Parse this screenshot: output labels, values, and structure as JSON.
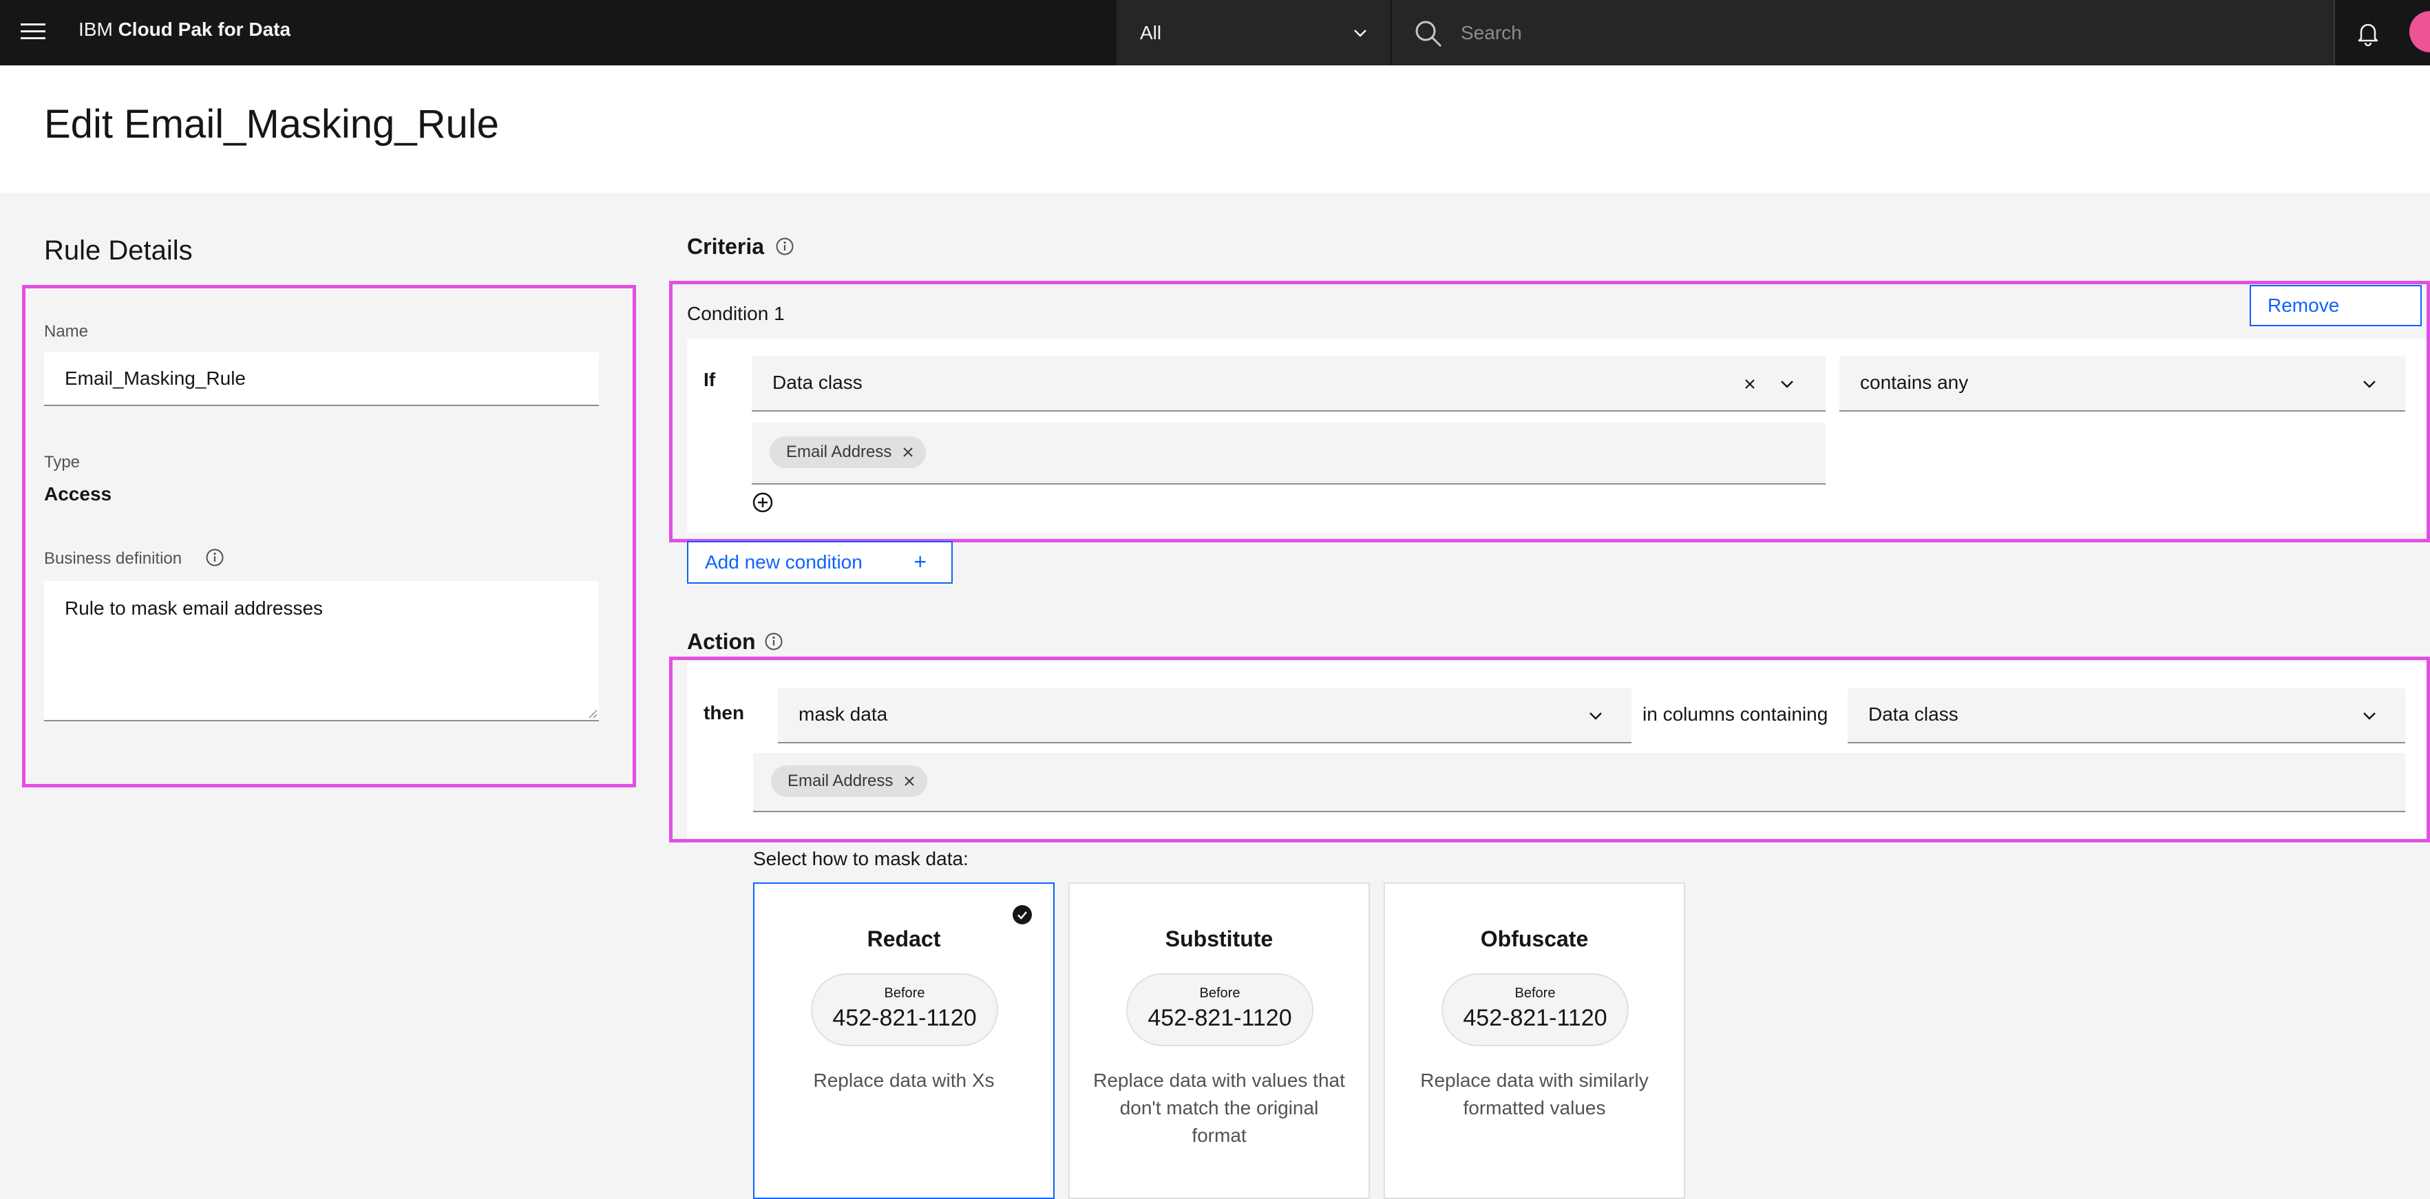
{
  "header": {
    "brand_prefix": "IBM",
    "brand_name": "Cloud Pak for Data",
    "scope_value": "All",
    "search_placeholder": "Search"
  },
  "page": {
    "title": "Edit Email_Masking_Rule"
  },
  "rule_details": {
    "title": "Rule Details",
    "name_label": "Name",
    "name_value": "Email_Masking_Rule",
    "type_label": "Type",
    "type_value": "Access",
    "business_definition_label": "Business definition",
    "business_definition_value": "Rule to mask email addresses"
  },
  "criteria": {
    "title": "Criteria",
    "condition_title": "Condition 1",
    "remove_label": "Remove",
    "if_label": "If",
    "field_value": "Data class",
    "operator_value": "contains any",
    "tags": [
      "Email Address"
    ],
    "add_condition_label": "Add new condition",
    "add_condition_plus": "+"
  },
  "action": {
    "title": "Action",
    "then_label": "then",
    "action_value": "mask data",
    "in_columns_label": "in columns containing",
    "column_value": "Data class",
    "tags": [
      "Email Address"
    ]
  },
  "masking": {
    "prompt": "Select how to mask data:",
    "options": [
      {
        "title": "Redact",
        "before_label": "Before",
        "before_value": "452-821-1120",
        "description": "Replace data with Xs",
        "selected": true
      },
      {
        "title": "Substitute",
        "before_label": "Before",
        "before_value": "452-821-1120",
        "description": "Replace data with values that don't match the original format",
        "selected": false
      },
      {
        "title": "Obfuscate",
        "before_label": "Before",
        "before_value": "452-821-1120",
        "description": "Replace data with similarly formatted values",
        "selected": false
      }
    ]
  },
  "icons": {
    "menu": "hamburger-menu-icon",
    "search": "search-icon",
    "notification": "bell-icon",
    "info": "info-icon",
    "chevron": "chevron-down-icon",
    "close": "close-icon",
    "add": "add-circle-icon",
    "checkmark": "checkmark-filled-icon"
  },
  "colors": {
    "accent": "#0f62fe",
    "header_bg": "#161616",
    "highlight": "#e34fe3"
  }
}
